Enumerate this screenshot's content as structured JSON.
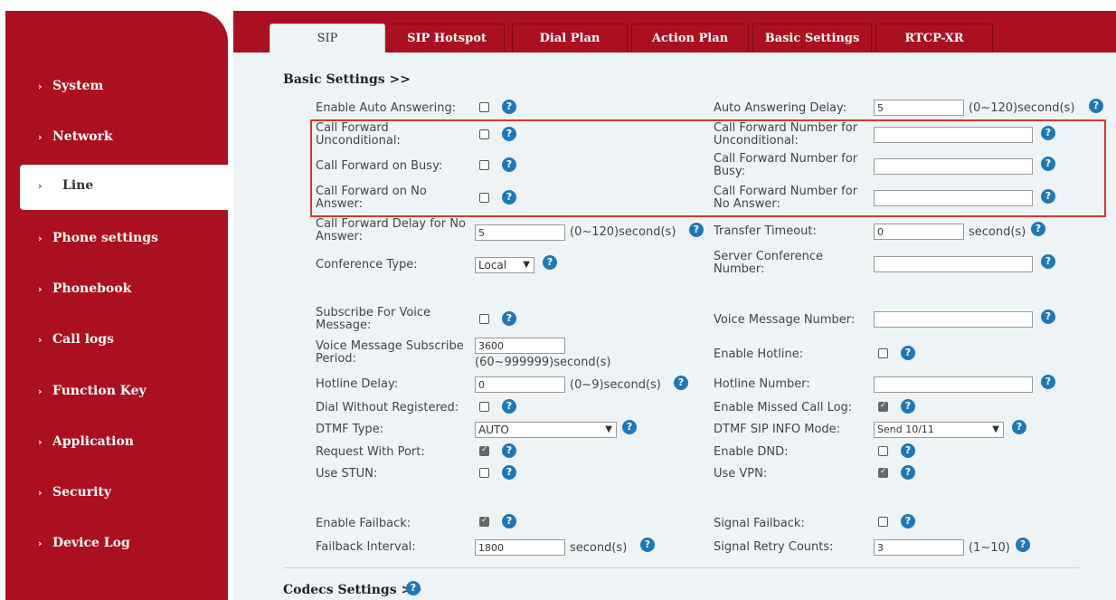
{
  "sidebar": {
    "items": [
      {
        "label": "System"
      },
      {
        "label": "Network"
      },
      {
        "label": "Line"
      },
      {
        "label": "Phone settings"
      },
      {
        "label": "Phonebook"
      },
      {
        "label": "Call logs"
      },
      {
        "label": "Function Key"
      },
      {
        "label": "Application"
      },
      {
        "label": "Security"
      },
      {
        "label": "Device Log"
      }
    ],
    "active": "Line"
  },
  "tabs": [
    {
      "label": "SIP"
    },
    {
      "label": "SIP Hotspot"
    },
    {
      "label": "Dial Plan"
    },
    {
      "label": "Action Plan"
    },
    {
      "label": "Basic Settings"
    },
    {
      "label": "RTCP-XR"
    }
  ],
  "active_tab": "SIP",
  "basic": {
    "title": "Basic Settings >>",
    "auto_answer": {
      "label": "Enable Auto Answering:",
      "checked": false
    },
    "auto_answer_delay": {
      "label": "Auto Answering Delay:",
      "value": "5",
      "unit": "(0~120)second(s)"
    },
    "cf_uncond": {
      "label1": "Call Forward",
      "label2": "Unconditional:",
      "checked": false
    },
    "cf_uncond_num": {
      "label1": "Call Forward Number for",
      "label2": "Unconditional:",
      "value": ""
    },
    "cf_busy": {
      "label": "Call Forward on Busy:",
      "checked": false
    },
    "cf_busy_num": {
      "label1": "Call Forward Number for",
      "label2": "Busy:",
      "value": ""
    },
    "cf_noans": {
      "label1": "Call Forward on No",
      "label2": "Answer:",
      "checked": false
    },
    "cf_noans_num": {
      "label1": "Call Forward Number for",
      "label2": "No Answer:",
      "value": ""
    },
    "cf_delay": {
      "label1": "Call Forward Delay for No",
      "label2": "Answer:",
      "value": "5",
      "unit": "(0~120)second(s)"
    },
    "transfer_timeout": {
      "label": "Transfer Timeout:",
      "value": "0",
      "unit": "second(s)"
    },
    "conf_type": {
      "label": "Conference Type:",
      "value": "Local"
    },
    "server_conf": {
      "label1": "Server Conference",
      "label2": "Number:",
      "value": ""
    },
    "sub_voice": {
      "label1": "Subscribe For Voice",
      "label2": "Message:",
      "checked": false
    },
    "voice_msg_num": {
      "label": "Voice Message Number:",
      "value": ""
    },
    "vm_sub_period": {
      "label1": "Voice Message Subscribe",
      "label2": "Period:",
      "value": "3600",
      "unit": "(60~999999)second(s)"
    },
    "hotline": {
      "label": "Enable Hotline:",
      "checked": false
    },
    "hotline_delay": {
      "label": "Hotline Delay:",
      "value": "0",
      "unit": "(0~9)second(s)"
    },
    "hotline_num": {
      "label": "Hotline Number:",
      "value": ""
    },
    "dial_wo_reg": {
      "label": "Dial Without Registered:",
      "checked": false
    },
    "missed_log": {
      "label": "Enable Missed Call Log:",
      "checked": true
    },
    "dtmf_type": {
      "label": "DTMF Type:",
      "value": "AUTO"
    },
    "dtmf_sip_info": {
      "label": "DTMF SIP INFO Mode:",
      "value": "Send 10/11"
    },
    "req_port": {
      "label": "Request With Port:",
      "checked": true
    },
    "dnd": {
      "label": "Enable DND:",
      "checked": false
    },
    "stun": {
      "label": "Use STUN:",
      "checked": false
    },
    "vpn": {
      "label": "Use VPN:",
      "checked": true
    },
    "failback": {
      "label": "Enable Failback:",
      "checked": true
    },
    "signal_failback": {
      "label": "Signal Failback:",
      "checked": false
    },
    "failback_interval": {
      "label": "Failback Interval:",
      "value": "1800",
      "unit": "second(s)"
    },
    "retry_counts": {
      "label": "Signal Retry Counts:",
      "value": "3",
      "unit": "(1~10)"
    }
  },
  "codecs": {
    "title": "Codecs Settings >>"
  },
  "help_glyph": "?",
  "colors": {
    "brand": "#aa1020",
    "panel": "#eef4f6",
    "help": "#1e78b8",
    "highlight": "#e23232"
  }
}
